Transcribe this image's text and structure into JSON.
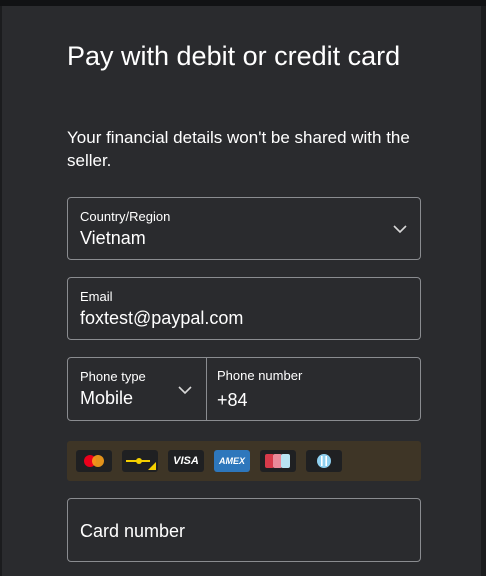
{
  "header": {
    "title": "Pay with debit or credit card",
    "subtitle": "Your financial details won't be shared with the seller."
  },
  "form": {
    "country": {
      "label": "Country/Region",
      "value": "Vietnam"
    },
    "email": {
      "label": "Email",
      "value": "foxtest@paypal.com"
    },
    "phone_type": {
      "label": "Phone type",
      "value": "Mobile"
    },
    "phone_number": {
      "label": "Phone number",
      "value": "+84"
    },
    "card_number": {
      "placeholder": "Card number"
    }
  },
  "accepted_cards": [
    {
      "name": "mastercard-icon",
      "text": ""
    },
    {
      "name": "maestro-icon",
      "text": ""
    },
    {
      "name": "visa-icon",
      "text": "VISA"
    },
    {
      "name": "amex-icon",
      "text": "AMEX"
    },
    {
      "name": "jcb-icon",
      "text": ""
    },
    {
      "name": "diners-club-icon",
      "text": ""
    }
  ],
  "colors": {
    "background": "#2a2b2e",
    "border": "#8a8c90",
    "cards_strip": "#3e3526",
    "amex_blue": "#2e77bc"
  }
}
